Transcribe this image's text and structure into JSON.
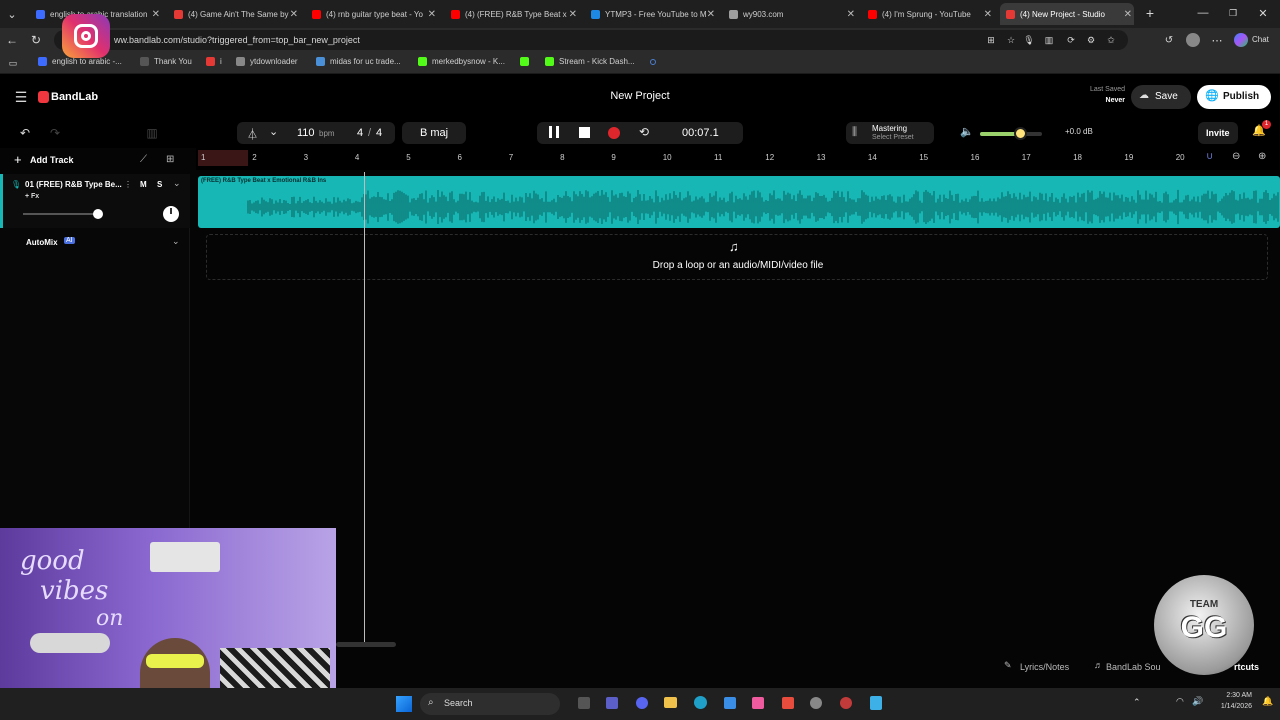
{
  "browser": {
    "tabs": [
      {
        "label": "english to arabic translation",
        "color": "#3d6bff",
        "active": false
      },
      {
        "label": "(4) Game Ain't The Same by",
        "color": "#e53935",
        "active": false
      },
      {
        "label": "(4) rnb guitar type beat - Yo",
        "color": "#ff0000",
        "active": false
      },
      {
        "label": "(4) (FREE) R&B Type Beat x E",
        "color": "#ff0000",
        "active": false
      },
      {
        "label": "YTMP3 - Free YouTube to M",
        "color": "#1e88e5",
        "active": false
      },
      {
        "label": "wy903.com",
        "color": "#9e9e9e",
        "active": false
      },
      {
        "label": "(4) I'm Sprung - YouTube",
        "color": "#ff0000",
        "active": false
      },
      {
        "label": "(4) New Project - Studio",
        "color": "#e53935",
        "active": true
      }
    ],
    "url": "ww.bandlab.com/studio?triggered_from=top_bar_new_project",
    "bookmarks": [
      {
        "label": "english to arabic -...",
        "color": "#3d6bff"
      },
      {
        "label": "Thank You",
        "color": "#555555"
      },
      {
        "label": "i",
        "color": "#e53935"
      },
      {
        "label": "ytdownloader",
        "color": "#888888"
      },
      {
        "label": "midas for uc trade...",
        "color": "#4a90d9"
      },
      {
        "label": "merkedbysnow - K...",
        "color": "#53fc18"
      },
      {
        "label": "",
        "color": "#53fc18"
      },
      {
        "label": "Stream - Kick Dash...",
        "color": "#53fc18"
      }
    ],
    "chat_label": "Chat"
  },
  "studio": {
    "brand": "BandLab",
    "project_title": "New Project",
    "last_saved_label": "Last Saved",
    "last_saved_value": "Never",
    "save_label": "Save",
    "publish_label": "Publish",
    "tempo": "110",
    "tempo_unit": "bpm",
    "time_sig_num": "4",
    "time_sig_sep": "/",
    "time_sig_den": "4",
    "key": "B maj",
    "time": "00:07.1",
    "mastering_label": "Mastering",
    "mastering_preset": "Select Preset",
    "volume_db": "+0.0 dB",
    "volume_level": 0.65,
    "invite_label": "Invite",
    "notif_count": "1",
    "add_track_label": "Add Track",
    "track_name": "01 (FREE) R&B Type Be...",
    "track_m": "M",
    "track_s": "S",
    "track_fx": "+ Fx",
    "automix_label": "AutoMix",
    "automix_badge": "AI",
    "clip_name": "(FREE) R&B Type Beat x Emotional R&B Ins",
    "drop_text": "Drop a loop or an audio/MIDI/video file",
    "ruler": [
      "1",
      "2",
      "3",
      "4",
      "5",
      "6",
      "7",
      "8",
      "9",
      "10",
      "11",
      "12",
      "13",
      "14",
      "15",
      "16",
      "17",
      "18",
      "19",
      "20"
    ],
    "lyrics_label": "Lyrics/Notes",
    "sounds_label": "BandLab Sou",
    "shortcuts_label": "rtcuts"
  },
  "overlay": {
    "webcam_text_1": "good",
    "webcam_text_2": "vibes",
    "webcam_text_3": "on",
    "team_logo_top": "TEAM",
    "team_logo_main": "GG"
  },
  "taskbar": {
    "search_label": "Search",
    "time": "2:30 AM",
    "date": "1/14/2026"
  }
}
